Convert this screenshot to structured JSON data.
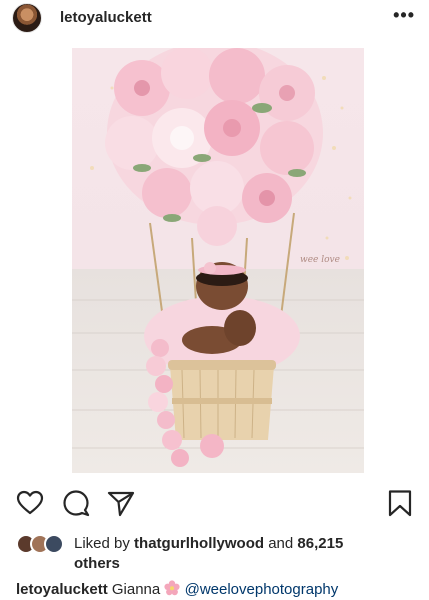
{
  "post": {
    "username": "letoyaluckett",
    "more_label": "•••"
  },
  "icons": {
    "more": "more-options-icon",
    "like": "heart-icon",
    "comment": "comment-bubble-icon",
    "share": "paper-plane-icon",
    "save": "bookmark-icon",
    "caption_emoji": "cherry-blossom-icon"
  },
  "image": {
    "watermark": "wee love"
  },
  "likes": {
    "prefix": "Liked by ",
    "user": "thatgurlhollywood",
    "middle": " and ",
    "count": "86,215",
    "suffix": "others"
  },
  "caption": {
    "username": "letoyaluckett",
    "text": "Gianna",
    "mention": "@weelovephotography"
  },
  "colors": {
    "text": "#262626",
    "mention": "#00376b",
    "pink": "#f4b6c6"
  }
}
